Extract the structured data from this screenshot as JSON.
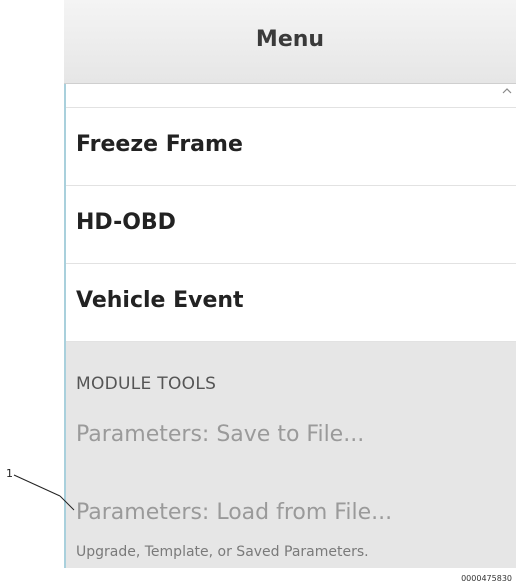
{
  "header": {
    "title": "Menu"
  },
  "menu": {
    "items": [
      {
        "label": "Freeze Frame"
      },
      {
        "label": "HD-OBD"
      },
      {
        "label": "Vehicle Event"
      }
    ],
    "section_label": "MODULE TOOLS",
    "tools": [
      {
        "label": "Parameters: Save to File..."
      },
      {
        "label": "Parameters: Load from File...",
        "sublabel": "Upgrade, Template, or Saved Parameters."
      }
    ]
  },
  "annotation": {
    "callout_number": "1",
    "figure_id": "0000475830"
  },
  "colors": {
    "header_bg": "#e6e6e6",
    "list_border": "#a9d0dc",
    "disabled_text": "#9a9a9a"
  },
  "icons": {
    "scroll": "chevron-up-icon"
  }
}
